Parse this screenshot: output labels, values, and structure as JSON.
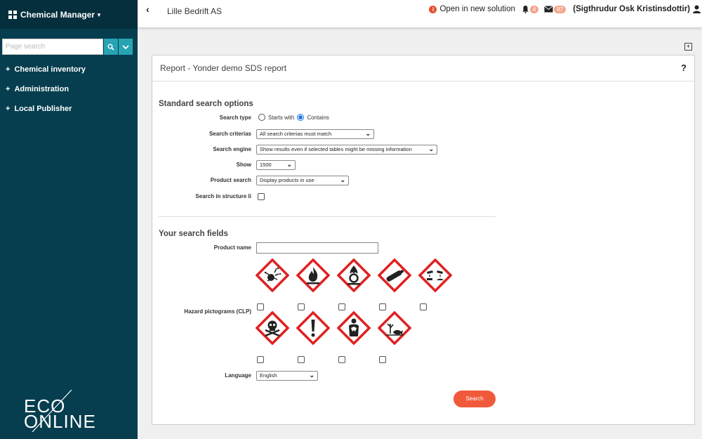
{
  "sidebar": {
    "app_name": "Chemical Manager",
    "search_placeholder": "Page search",
    "nav": [
      {
        "label": "Chemical inventory"
      },
      {
        "label": "Administration"
      },
      {
        "label": "Local Publisher"
      }
    ],
    "logo_top": "ECO",
    "logo_bottom": "ONLINE"
  },
  "header": {
    "company": "Lille Bedrift AS",
    "open_new": "Open in new solution",
    "notif_count": "4",
    "mail_count": "87",
    "user": "(Sigthrudur Osk Kristinsdottir)"
  },
  "panel": {
    "title": "Report - Yonder demo SDS report",
    "help": "?"
  },
  "standard": {
    "title": "Standard search options",
    "search_type_label": "Search type",
    "starts_with": "Starts with",
    "contains": "Contains",
    "criterias_label": "Search criterias",
    "criterias_value": "All search criterias must match",
    "engine_label": "Search engine",
    "engine_value": "Show results even if selected tables might be missing information",
    "show_label": "Show",
    "show_value": "1500",
    "product_search_label": "Product search",
    "product_search_value": "Display products in use",
    "structure_label": "Search in structure li"
  },
  "fields": {
    "title": "Your search fields",
    "product_name_label": "Product name",
    "hazard_label": "Hazard pictograms (CLP)",
    "language_label": "Language",
    "language_value": "English",
    "search_button": "Search"
  },
  "colors": {
    "sidebar": "#063e4f",
    "accent": "#27a3b2",
    "button": "#f05a3a",
    "ghs_red": "#e02020"
  }
}
